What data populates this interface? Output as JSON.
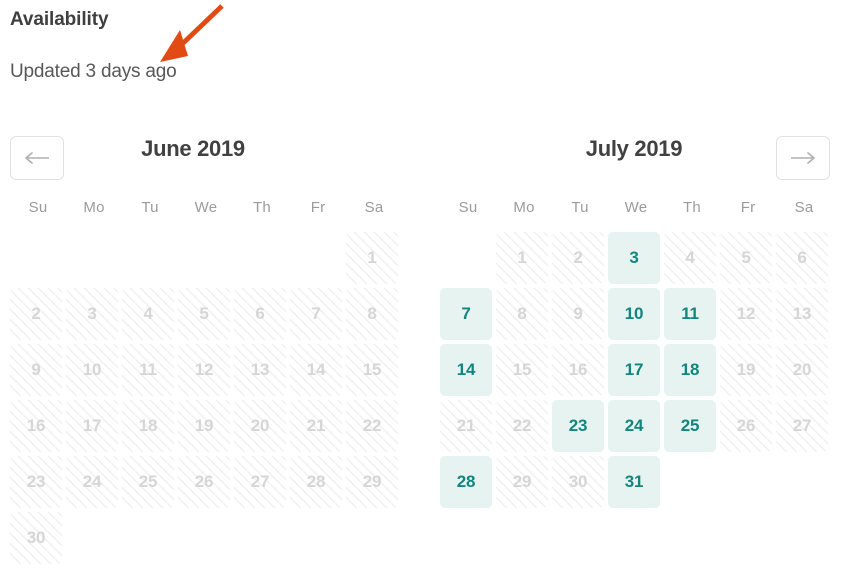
{
  "header": {
    "title": "Availability",
    "updated": "Updated 3 days ago"
  },
  "annotation": {
    "type": "arrow",
    "color": "#e24a13",
    "direction": "down-left"
  },
  "nav": {
    "prev_label": "←",
    "next_label": "→",
    "prev_icon": "arrow-left-icon",
    "next_icon": "arrow-right-icon"
  },
  "colors": {
    "available_bg": "#e6f3f1",
    "available_text": "#13857c",
    "unavailable_text": "#d6d6d6",
    "hatch_line": "#f0f0f0",
    "title_text": "#414141",
    "weekday_text": "#9b9b9b",
    "annotation": "#e24a13"
  },
  "weekdays": [
    "Su",
    "Mo",
    "Tu",
    "We",
    "Th",
    "Fr",
    "Sa"
  ],
  "months": [
    {
      "id": "june",
      "title": "June 2019",
      "lead_blanks": 6,
      "days": [
        {
          "n": "1",
          "state": "unavailable"
        },
        {
          "n": "2",
          "state": "unavailable"
        },
        {
          "n": "3",
          "state": "unavailable"
        },
        {
          "n": "4",
          "state": "unavailable"
        },
        {
          "n": "5",
          "state": "unavailable"
        },
        {
          "n": "6",
          "state": "unavailable"
        },
        {
          "n": "7",
          "state": "unavailable"
        },
        {
          "n": "8",
          "state": "unavailable"
        },
        {
          "n": "9",
          "state": "unavailable"
        },
        {
          "n": "10",
          "state": "unavailable"
        },
        {
          "n": "11",
          "state": "unavailable"
        },
        {
          "n": "12",
          "state": "unavailable"
        },
        {
          "n": "13",
          "state": "unavailable"
        },
        {
          "n": "14",
          "state": "unavailable"
        },
        {
          "n": "15",
          "state": "unavailable"
        },
        {
          "n": "16",
          "state": "unavailable"
        },
        {
          "n": "17",
          "state": "unavailable"
        },
        {
          "n": "18",
          "state": "unavailable"
        },
        {
          "n": "19",
          "state": "unavailable"
        },
        {
          "n": "20",
          "state": "unavailable"
        },
        {
          "n": "21",
          "state": "unavailable"
        },
        {
          "n": "22",
          "state": "unavailable"
        },
        {
          "n": "23",
          "state": "unavailable"
        },
        {
          "n": "24",
          "state": "unavailable"
        },
        {
          "n": "25",
          "state": "unavailable"
        },
        {
          "n": "26",
          "state": "unavailable"
        },
        {
          "n": "27",
          "state": "unavailable"
        },
        {
          "n": "28",
          "state": "unavailable"
        },
        {
          "n": "29",
          "state": "unavailable"
        },
        {
          "n": "30",
          "state": "unavailable"
        }
      ]
    },
    {
      "id": "july",
      "title": "July 2019",
      "lead_blanks": 1,
      "days": [
        {
          "n": "1",
          "state": "unavailable"
        },
        {
          "n": "2",
          "state": "unavailable"
        },
        {
          "n": "3",
          "state": "available"
        },
        {
          "n": "4",
          "state": "unavailable"
        },
        {
          "n": "5",
          "state": "unavailable"
        },
        {
          "n": "6",
          "state": "unavailable"
        },
        {
          "n": "7",
          "state": "available"
        },
        {
          "n": "8",
          "state": "unavailable"
        },
        {
          "n": "9",
          "state": "unavailable"
        },
        {
          "n": "10",
          "state": "available"
        },
        {
          "n": "11",
          "state": "available"
        },
        {
          "n": "12",
          "state": "unavailable"
        },
        {
          "n": "13",
          "state": "unavailable"
        },
        {
          "n": "14",
          "state": "available"
        },
        {
          "n": "15",
          "state": "unavailable"
        },
        {
          "n": "16",
          "state": "unavailable"
        },
        {
          "n": "17",
          "state": "available"
        },
        {
          "n": "18",
          "state": "available"
        },
        {
          "n": "19",
          "state": "unavailable"
        },
        {
          "n": "20",
          "state": "unavailable"
        },
        {
          "n": "21",
          "state": "unavailable"
        },
        {
          "n": "22",
          "state": "unavailable"
        },
        {
          "n": "23",
          "state": "available"
        },
        {
          "n": "24",
          "state": "available"
        },
        {
          "n": "25",
          "state": "available"
        },
        {
          "n": "26",
          "state": "unavailable"
        },
        {
          "n": "27",
          "state": "unavailable"
        },
        {
          "n": "28",
          "state": "available"
        },
        {
          "n": "29",
          "state": "unavailable"
        },
        {
          "n": "30",
          "state": "unavailable"
        },
        {
          "n": "31",
          "state": "available"
        }
      ]
    }
  ]
}
